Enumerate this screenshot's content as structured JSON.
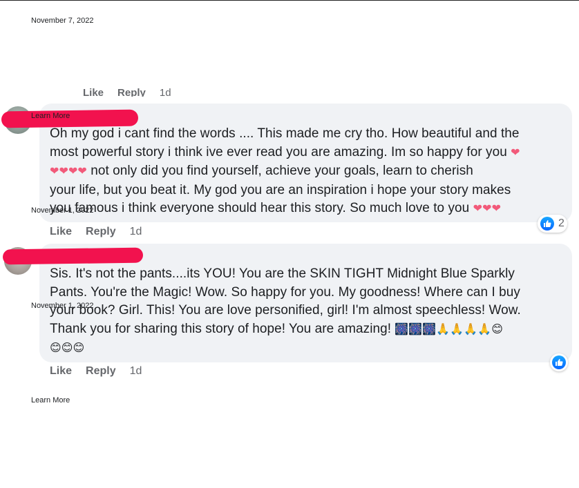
{
  "overlay": {
    "date_top": "November 7, 2022",
    "learn_more_1": "Learn More",
    "date_mid_1": "November 1, 2022",
    "date_mid_2": "November 1, 2022",
    "learn_more_2": "Learn More"
  },
  "previous_comment": {
    "like_label": "Like",
    "reply_label": "Reply",
    "time": "1d"
  },
  "comments": [
    {
      "lines": [
        "Oh my god i cant find the words .... This made me cry tho. How beautiful and the",
        "most powerful story i think ive ever read you are amazing. Im so happy for you ❤",
        "❤❤❤❤ not only did you find yourself, achieve your goals, learn to cherish",
        "your life, but you beat it. My god you are an inspiration i hope your story makes",
        "you famous i think everyone should hear this story. So much love to you ❤❤❤"
      ],
      "like_label": "Like",
      "reply_label": "Reply",
      "time": "1d",
      "reaction_count": "2"
    },
    {
      "lines": [
        "Sis. It's not the pants....its YOU! You are the SKIN TIGHT Midnight Blue Sparkly",
        "Pants. You're the Magic! Wow. So happy for you. My goodness! Where can I buy",
        "your book? Girl. This! You are love personified, girl! I'm almost speechless! Wow.",
        "Thank you for sharing this story of hope! You are amazing! 🎆🎆🎆🙏🙏🙏🙏😊",
        "😊😊😊"
      ],
      "like_label": "Like",
      "reply_label": "Reply",
      "time": "1d"
    }
  ],
  "colors": {
    "bubble": "#f0f2f5",
    "redaction": "#f2124e",
    "secondary_text": "#65676b",
    "like_blue": "#0866ff"
  }
}
